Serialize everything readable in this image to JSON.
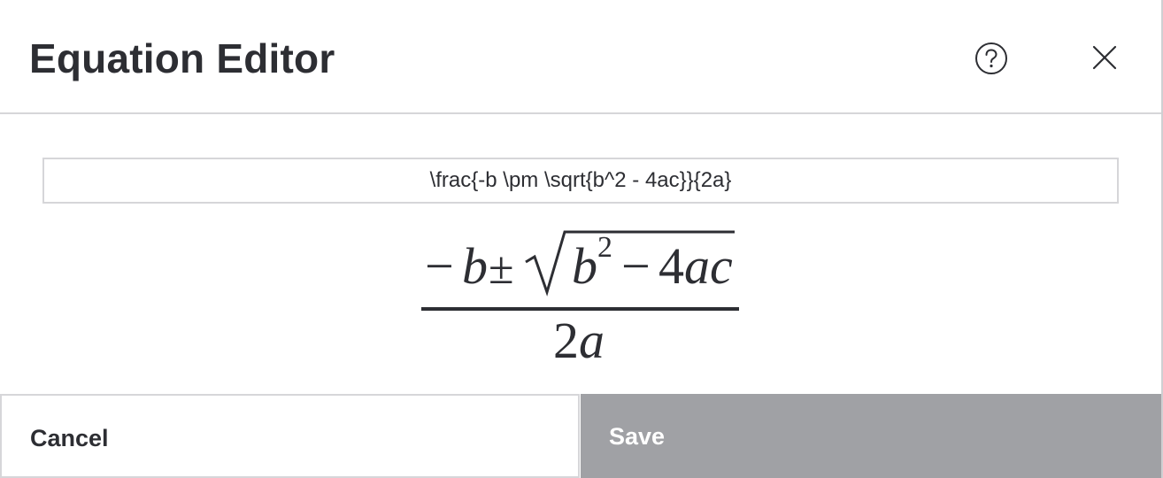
{
  "dialog": {
    "title": "Equation Editor",
    "help_icon": "help-circle-icon",
    "close_icon": "close-x-icon"
  },
  "editor": {
    "latex_value": "\\frac{-b \\pm \\sqrt{b^2 - 4ac}}{2a}"
  },
  "preview": {
    "numerator": {
      "minus": "−",
      "b": "b",
      "pm": "±",
      "radicand_b": "b",
      "exponent": "2",
      "minus2": "−",
      "four": "4",
      "ac": "ac"
    },
    "denominator": {
      "two": "2",
      "a": "a"
    }
  },
  "footer": {
    "cancel_label": "Cancel",
    "save_label": "Save"
  },
  "colors": {
    "text": "#2d2e33",
    "border": "#d6d6d9",
    "save_bg": "#a0a1a5",
    "background": "#ffffff"
  }
}
